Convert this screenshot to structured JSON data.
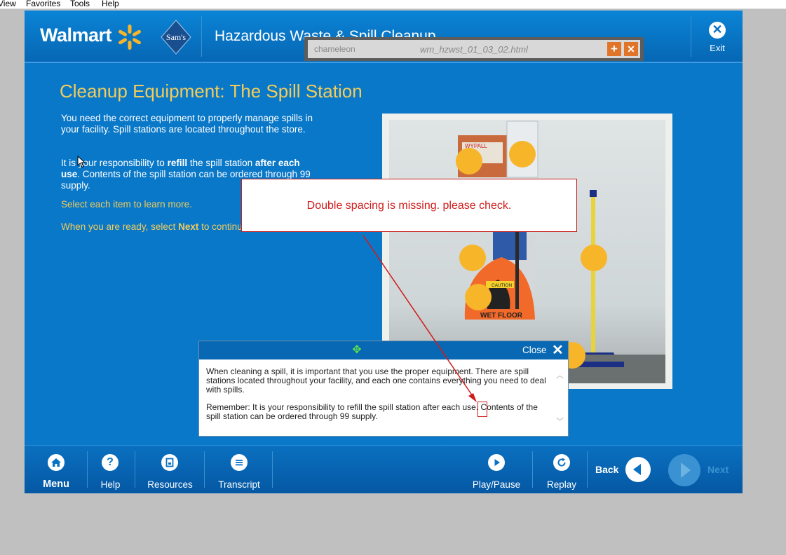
{
  "menubar": {
    "items": [
      "View",
      "Favorites",
      "Tools",
      "Help"
    ]
  },
  "header": {
    "brand": "Walmart",
    "sams_logo": "Sam's",
    "course_title": "Hazardous Waste & Spill Cleanup",
    "exit_label": "Exit"
  },
  "chameleon": {
    "logo": "chameleon",
    "filename": "wm_hzwst_01_03_02.html",
    "expand_label": "+",
    "close_label": "✕"
  },
  "content": {
    "title": "Cleanup Equipment:  The Spill Station",
    "para1": "You need the correct equipment to properly manage spills in your facility.  Spill stations are located throughout the store.",
    "para2_a": "It is your responsibility to ",
    "para2_b": "refill",
    "para2_c": " the spill station ",
    "para2_d": "after each use",
    "para2_e": ".  Contents of the spill station can be ordered through 99 supply.",
    "select_text": "Select each item to learn more.",
    "ready_a": "When you are ready, select ",
    "ready_b": "Next",
    "ready_c": " to continue."
  },
  "photo": {
    "caution_label": "CAUTION",
    "wet_floor_label": "WET FLOOR",
    "wypall_label": "WYPALL"
  },
  "review_comment": {
    "text": "Double spacing is missing. please check."
  },
  "transcript_popup": {
    "close_label": "Close",
    "para1": "When cleaning a spill, it is important that you use the proper equipment.  There are spill stations located throughout your facility, and each one contains everything you need to deal with spills.",
    "para2": "Remember:  It is your responsibility to refill the spill station after each use. Contents of the spill station can be ordered through 99 supply."
  },
  "footer": {
    "menu_label": "Menu",
    "help_label": "Help",
    "resources_label": "Resources",
    "transcript_label": "Transcript",
    "playpause_label": "Play/Pause",
    "replay_label": "Replay",
    "back_label": "Back",
    "next_label": "Next"
  },
  "colors": {
    "course_blue": "#0a78c8",
    "accent_yellow": "#f3cc5a",
    "hotspot": "#f7b52a",
    "review_red": "#d01b1b"
  }
}
